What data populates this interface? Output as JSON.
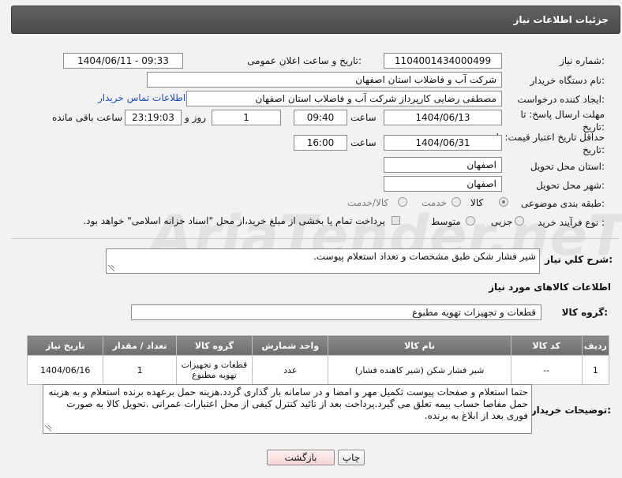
{
  "header": {
    "title": "جزئیات اطلاعات نیاز"
  },
  "watermark": {
    "text": "AriaTender.neT"
  },
  "form": {
    "need_number": {
      "label": "شماره نیاز:",
      "value": "1104001434000499"
    },
    "announce_datetime": {
      "label": "تاریخ و ساعت اعلان عمومی:",
      "value": "1404/06/11 - 09:33"
    },
    "buyer_org": {
      "label": "نام دستگاه خریدار:",
      "value": "شرکت آب و فاضلاب استان اصفهان"
    },
    "requester": {
      "label": "ایجاد کننده درخواست:",
      "value": "مصطفی رضایی کارپرداز شرکت آب و فاضلاب استان اصفهان",
      "contact_link": "اطلاعات تماس خریدار"
    },
    "deadline": {
      "label": "مهلت ارسال پاسخ: تا تاریخ:",
      "date": "1404/06/13",
      "time_label": "ساعت",
      "time": "09:40",
      "days": "1",
      "days_label": "روز و",
      "remaining": "23:19:03",
      "remaining_label": "ساعت باقی مانده"
    },
    "price_validity": {
      "label": "حداقل تاریخ اعتبار قیمت: تا تاریخ:",
      "date": "1404/06/31",
      "time_label": "ساعت",
      "time": "16:00"
    },
    "delivery_province": {
      "label": "استان محل تحویل:",
      "value": "اصفهان"
    },
    "delivery_city": {
      "label": "شهر محل تحویل:",
      "value": "اصفهان"
    },
    "category": {
      "label": "طبقه بندی موضوعی:",
      "options": [
        {
          "label": "کالا",
          "selected": true
        },
        {
          "label": "خدمت",
          "selected": false
        },
        {
          "label": "کالا/خدمت",
          "selected": false
        }
      ]
    },
    "process_type": {
      "label": "نوع فرآیند خرید :",
      "options": [
        {
          "label": "جزیی",
          "selected": false
        },
        {
          "label": "متوسط",
          "selected": false
        }
      ],
      "payment_text": "پرداخت تمام یا بخشی از مبلغ خرید،از محل \"اسناد خزانه اسلامی\" خواهد بود."
    },
    "description": {
      "label": "شرح کلي نياز:",
      "value": "شیر فشار شکن طبق مشخصات و تعداد استعلام پیوست."
    }
  },
  "goods": {
    "section_title": "اطلاعات کالاهای مورد نیاز",
    "group_label": "گروه کالا:",
    "group_value": "قطعات و تجهیزات تهویه مطبوع",
    "columns": [
      "ردیف",
      "کد کالا",
      "نام کالا",
      "واحد شمارش",
      "گروه کالا",
      "تعداد / مقدار",
      "تاریخ نیاز"
    ],
    "rows": [
      [
        "1",
        "--",
        "شیر فشار شکن (شیر کاهنده فشار)",
        "عدد",
        "قطعات و تجهیزات تهویه مطبوع",
        "1",
        "1404/06/16"
      ]
    ]
  },
  "buyer_notes": {
    "label": "توضیحات خریدار:",
    "value": "حتما استعلام و صفحات پیوست تکمیل مهر و امضا و در سامانه بار گذاری گردد.هزینه حمل برعهده برنده استعلام و به هزینه حمل مفاصا حساب بیمه تعلق می گیرد.پرداخت بعد از تائید کنترل کیفی از محل اعتبارات عمرانی .تحویل کالا به صورت فوری بعد از ابلاغ به برنده."
  },
  "buttons": {
    "print": "چاپ",
    "back": "بازگشت"
  }
}
